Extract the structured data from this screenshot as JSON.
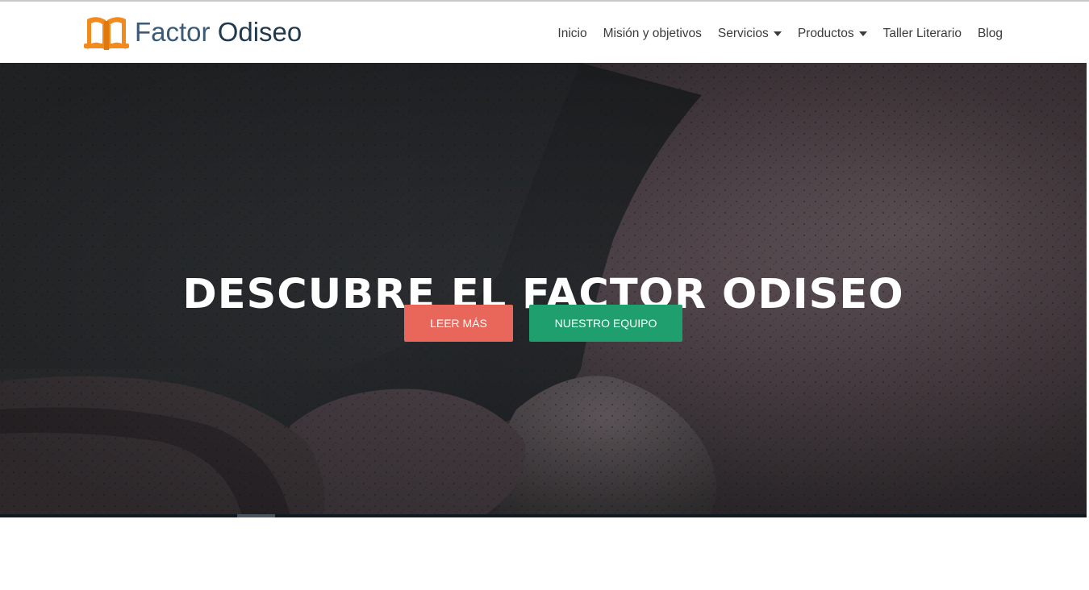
{
  "brand": {
    "name_part1": "Factor",
    "name_part2": "Odiseo",
    "icon": "open-book-icon",
    "icon_color": "#f28a1e"
  },
  "nav": {
    "items": [
      {
        "label": "Inicio",
        "dropdown": false
      },
      {
        "label": "Misión y objetivos",
        "dropdown": false
      },
      {
        "label": "Servicios",
        "dropdown": true
      },
      {
        "label": "Productos",
        "dropdown": true
      },
      {
        "label": "Taller Literario",
        "dropdown": false
      },
      {
        "label": "Blog",
        "dropdown": false
      }
    ]
  },
  "hero": {
    "title": "DESCUBRE EL FACTOR ODISEO",
    "primary_button": "LEER MÁS",
    "secondary_button": "NUESTRO EQUIPO",
    "primary_color": "#e8675a",
    "secondary_color": "#1f9f6e"
  }
}
